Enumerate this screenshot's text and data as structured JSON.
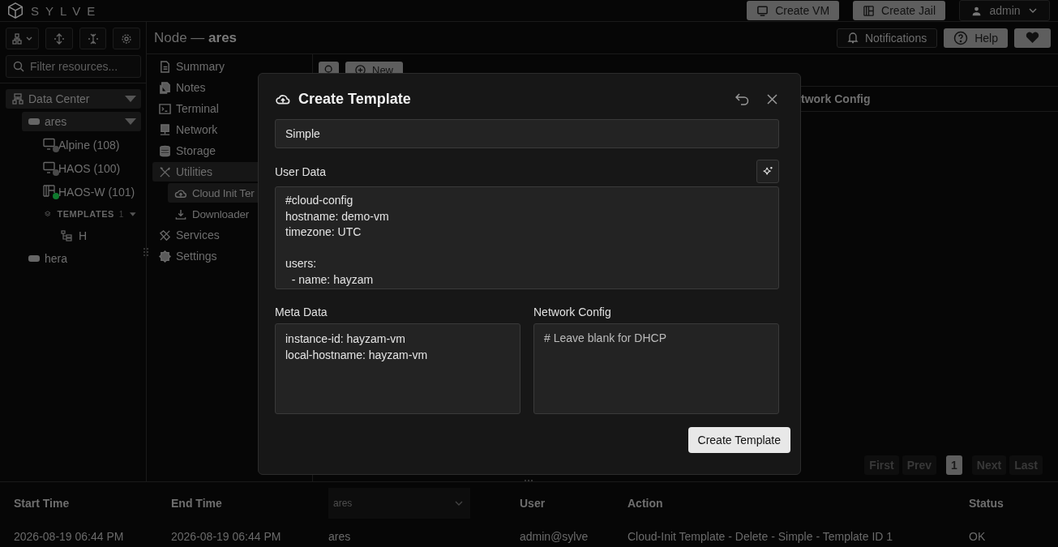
{
  "app": {
    "logo_text": "SYLVE"
  },
  "header_buttons": [
    {
      "label": "Create VM",
      "kind": "vm"
    },
    {
      "label": "Create Jail",
      "kind": "jail"
    }
  ],
  "user_menu": {
    "label": "admin"
  },
  "sidebar": {
    "filter": {
      "placeholder": "Filter resources..."
    },
    "tree": [
      {
        "label": "Data Center",
        "kind": "datacenter",
        "expanded": true,
        "children": [
          {
            "label": "ares",
            "kind": "node",
            "expanded": true,
            "children": [
              {
                "label": "Alpine (108)",
                "kind": "vm",
                "color": "#4a4a4a"
              },
              {
                "label": "HAOS (100)",
                "kind": "vm",
                "color": "#4a4a4a"
              },
              {
                "label": "HAOS-W (101)",
                "kind": "jail",
                "color": "#0f7a2e"
              },
              {
                "label": "TEMPLATES",
                "kind": "templates",
                "count": "1",
                "expanded": true,
                "children": [
                  {
                    "label": "H",
                    "kind": "template"
                  }
                ]
              }
            ]
          },
          {
            "label": "hera",
            "kind": "node"
          }
        ]
      }
    ]
  },
  "page_title": {
    "prefix": "Node —",
    "name": "ares"
  },
  "top_buttons": [
    {
      "label": "Notifications",
      "kind": "bell"
    },
    {
      "label": "Help",
      "kind": "help"
    },
    {
      "kind": "heart"
    }
  ],
  "nav": [
    {
      "label": "Summary",
      "kind": "summary",
      "selected": false
    },
    {
      "label": "Notes",
      "kind": "notes",
      "selected": false
    },
    {
      "label": "Terminal",
      "kind": "terminal",
      "selected": false
    },
    {
      "label": "Network",
      "kind": "network",
      "selected": false
    },
    {
      "label": "Storage",
      "kind": "storage",
      "selected": false
    },
    {
      "label": "Utilities",
      "kind": "utilities",
      "selected": true,
      "children": [
        {
          "label": "Cloud Init Ter",
          "kind": "cloud",
          "selected": true
        },
        {
          "label": "Downloader",
          "kind": "download",
          "selected": false
        }
      ]
    },
    {
      "label": "Services",
      "kind": "services",
      "selected": false
    },
    {
      "label": "Settings",
      "kind": "settings",
      "selected": false
    }
  ],
  "toolbar": {
    "new_button": "New"
  },
  "table": {
    "columns": [
      "twork Config"
    ]
  },
  "pagination": [
    {
      "label": "First",
      "disabled": true,
      "selected": false
    },
    {
      "label": "Prev",
      "disabled": true,
      "selected": false
    },
    {
      "label": "1",
      "disabled": false,
      "selected": true
    },
    {
      "label": "Next",
      "disabled": true,
      "selected": false
    },
    {
      "label": "Last",
      "disabled": true,
      "selected": false
    }
  ],
  "modal": {
    "title": "Create Template",
    "name_field": {
      "value": "Simple"
    },
    "user_data": {
      "label": "User Data",
      "value": "#cloud-config\nhostname: demo-vm\ntimezone: UTC\n\nusers:\n  - name: hayzam"
    },
    "meta_data": {
      "label": "Meta Data",
      "value": "instance-id: hayzam-vm\nlocal-hostname: hayzam-vm"
    },
    "network_config": {
      "label": "Network Config",
      "placeholder": "# Leave blank for DHCP"
    },
    "submit": "Create Template"
  },
  "audit_log": {
    "columns": [
      "Start Time",
      "End Time",
      null,
      "User",
      "Action",
      "Status"
    ],
    "node_filter": {
      "value": "ares"
    },
    "rows": [
      [
        "2026-08-19 06:44 PM",
        "2026-08-19 06:44 PM",
        "ares",
        "admin@sylve",
        "Cloud-Init Template - Delete - Simple - Template ID 1",
        "OK"
      ]
    ]
  }
}
